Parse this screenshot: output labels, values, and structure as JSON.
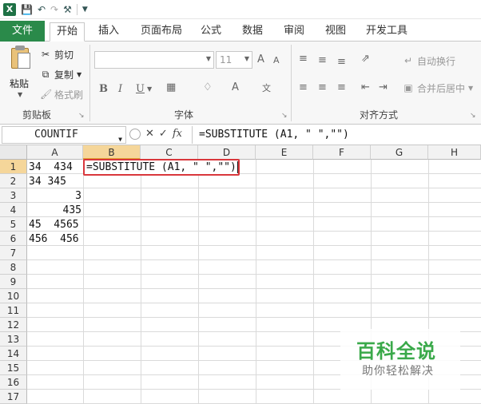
{
  "qat": {
    "undo_icon": "undo-icon",
    "redo_icon": "redo-icon",
    "save_icon": "save-icon",
    "customize_icon": "customize-icon"
  },
  "tabs": [
    "文件",
    "开始",
    "插入",
    "页面布局",
    "公式",
    "数据",
    "审阅",
    "视图",
    "开发工具"
  ],
  "ribbon": {
    "clipboard": {
      "paste": "粘贴",
      "cut": "剪切",
      "copy": "复制",
      "format_painter": "格式刷",
      "label": "剪贴板"
    },
    "font": {
      "size": "11",
      "bold": "B",
      "italic": "I",
      "underline": "U",
      "grow": "A",
      "shrink": "A",
      "label": "字体"
    },
    "alignment": {
      "wrap": "自动换行",
      "merge": "合并后居中",
      "label": "对齐方式"
    }
  },
  "formula_bar": {
    "name_box": "COUNTIF",
    "fx": "fx",
    "formula": "=SUBSTITUTE (A1, \" \",\"\")"
  },
  "columns": [
    "A",
    "B",
    "C",
    "D",
    "E",
    "F",
    "G",
    "H"
  ],
  "rows": [
    "1",
    "2",
    "3",
    "4",
    "5",
    "6",
    "7",
    "8",
    "9",
    "10",
    "11",
    "12",
    "13",
    "14",
    "15",
    "16",
    "17"
  ],
  "cells": {
    "a1": "34  434",
    "a2": "34 345",
    "a3": "3",
    "a4": "435",
    "a5": "45  4565",
    "a6": "456  456"
  },
  "active_cell_text": "=SUBSTITUTE (A1, \" \",\"\")",
  "watermark": {
    "title": "百科全说",
    "subtitle": "助你轻松解决"
  },
  "colors": {
    "file_tab": "#2a8a4a",
    "highlight": "#d9373c",
    "header_active": "#f5d69a"
  }
}
